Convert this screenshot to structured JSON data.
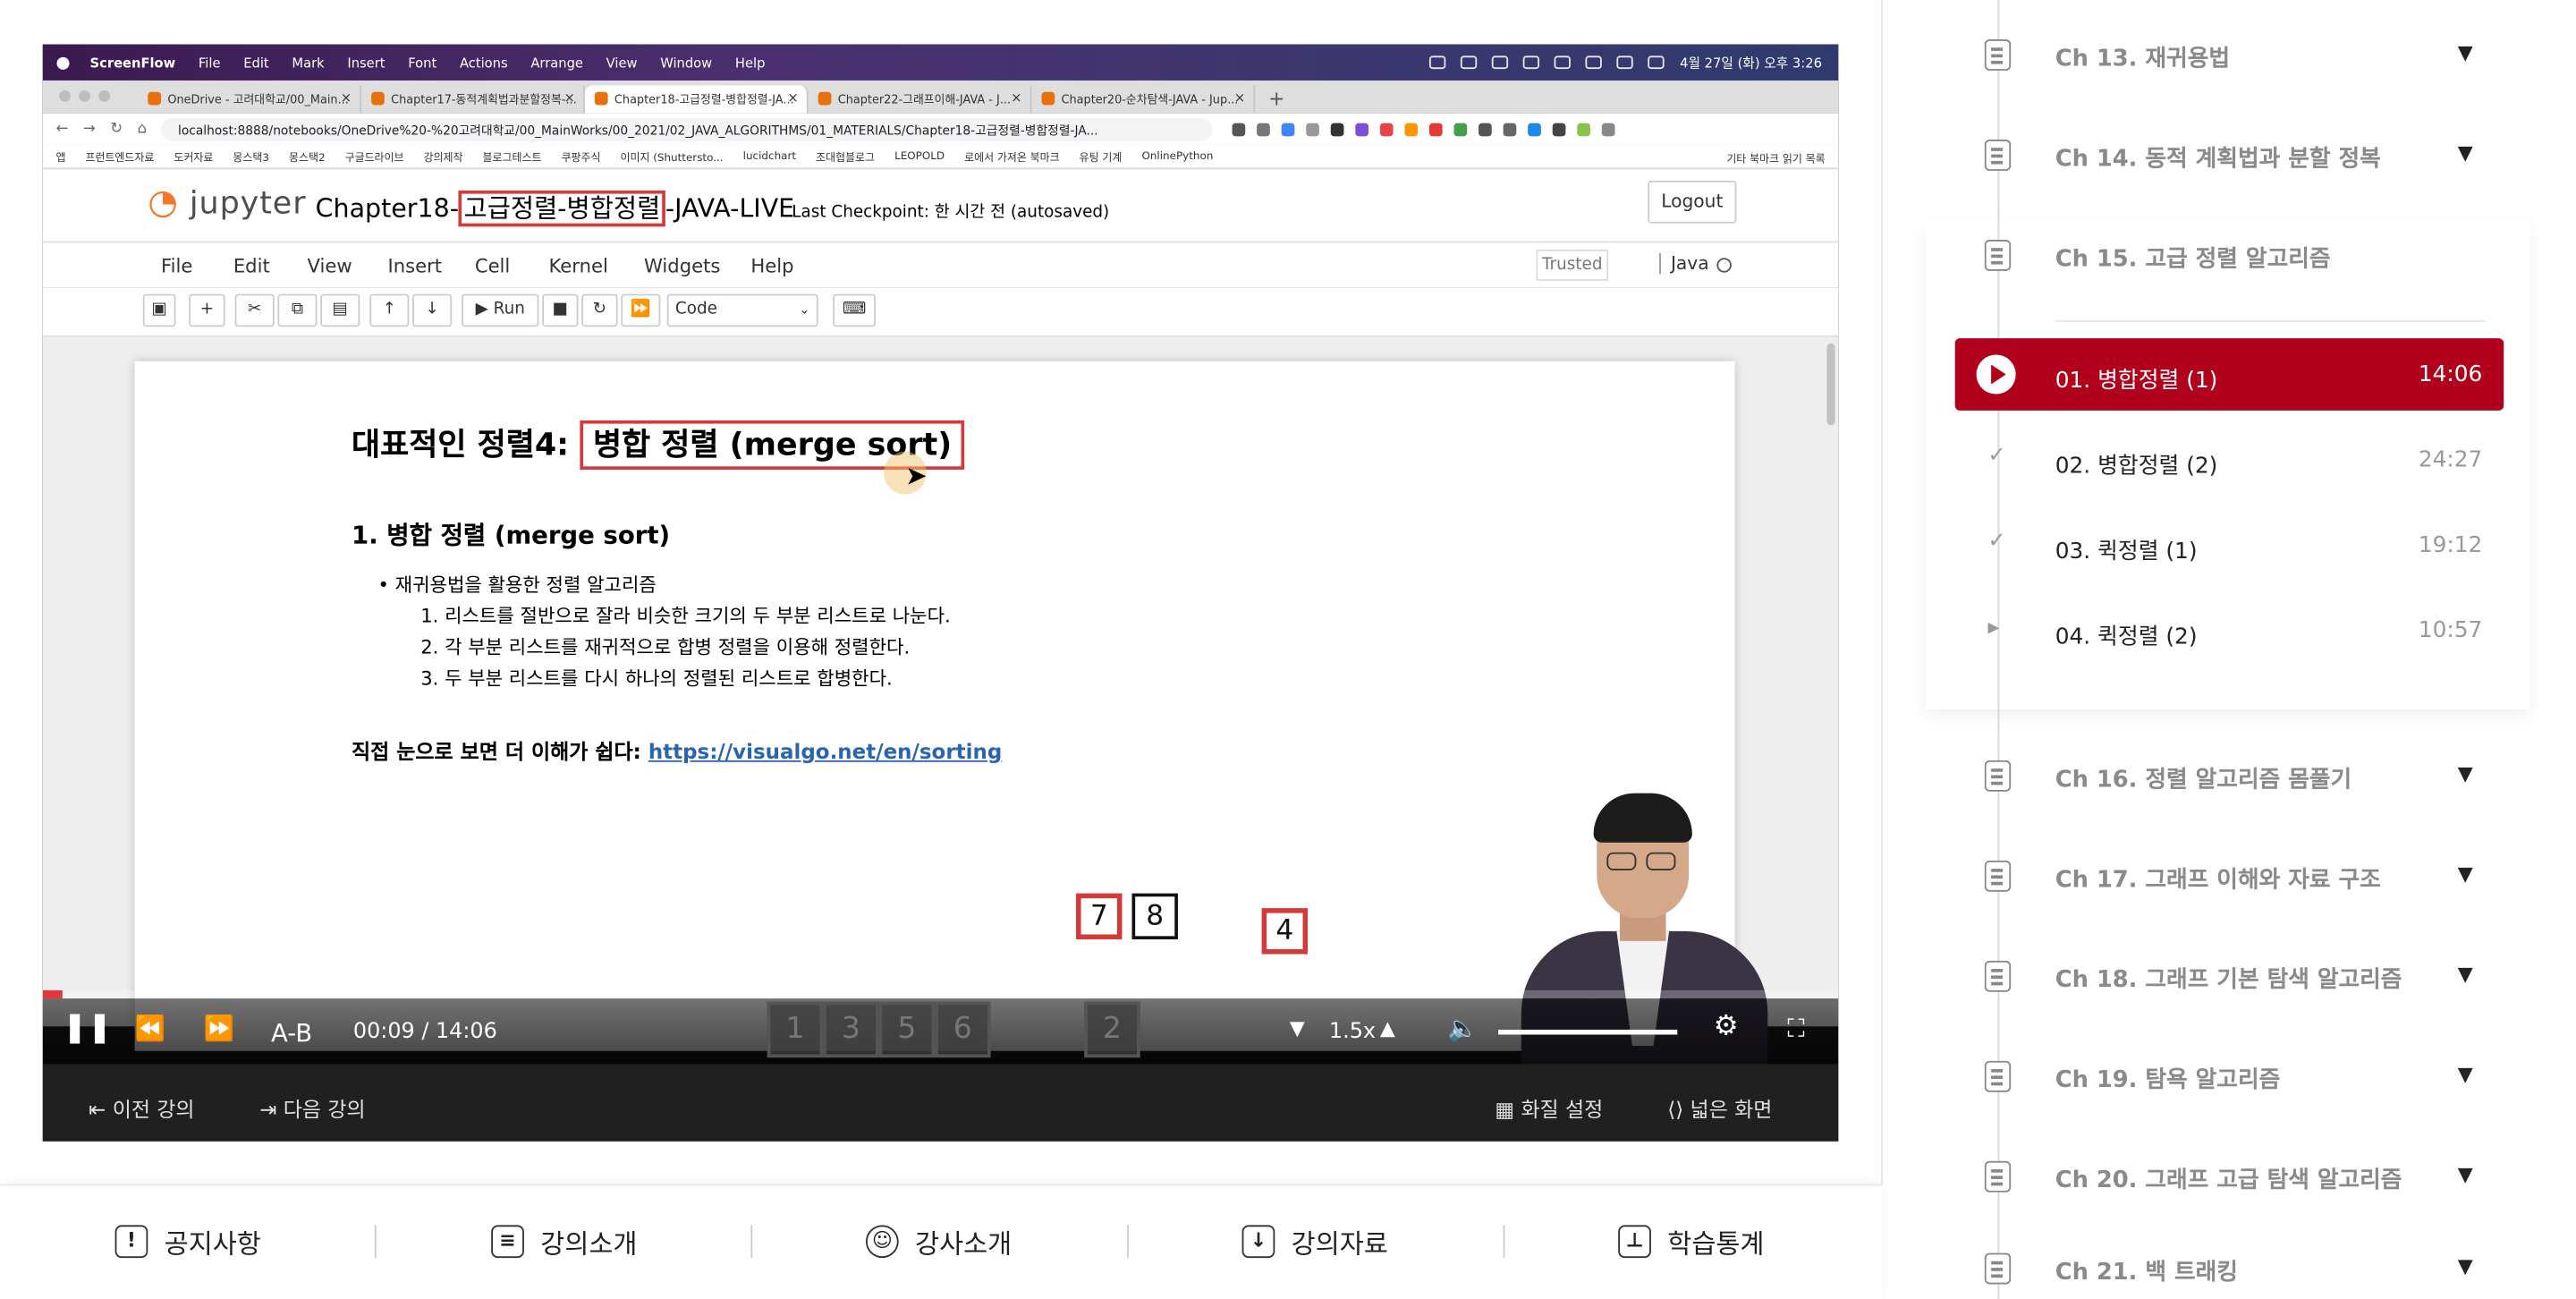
{
  "mac_menubar": {
    "app": "ScreenFlow",
    "items": [
      "File",
      "Edit",
      "Mark",
      "Insert",
      "Font",
      "Actions",
      "Arrange",
      "View",
      "Window",
      "Help"
    ],
    "clock": "4월 27일 (화) 오후 3:26"
  },
  "browser": {
    "tabs": [
      "OneDrive - 고려대학교/00_Main...",
      "Chapter17-동적계획법과분할정복-...",
      "Chapter18-고급정렬-병합정렬-JA...",
      "Chapter22-그래프이해-JAVA - J...",
      "Chapter20-순차탐색-JAVA - Jup..."
    ],
    "url": "localhost:8888/notebooks/OneDrive%20-%20고려대학교/00_MainWorks/00_2021/02_JAVA_ALGORITHMS/01_MATERIALS/Chapter18-고급정렬-병합정렬-JA...",
    "bookmarks": [
      "앱",
      "프런트엔드자료",
      "도커자료",
      "몽스택3",
      "몽스택2",
      "구글드라이브",
      "강의제작",
      "블로그테스트",
      "쿠팡주식",
      "이미지 (Shuttersto...",
      "lucidchart",
      "조대협블로그",
      "LEOPOLD",
      "로에서 가져온 북마크",
      "유팅 기계",
      "OnlinePython"
    ],
    "bookmarks_right": [
      "기타 북마크",
      "읽기 목록"
    ]
  },
  "jupyter": {
    "logo": "jupyter",
    "title_prefix": "Chapter18-",
    "title_highlight": "고급정렬-병합정렬",
    "title_suffix": "-JAVA-LIVE",
    "checkpoint": "Last Checkpoint: 한 시간 전  (autosaved)",
    "logout": "Logout",
    "menu": [
      "File",
      "Edit",
      "View",
      "Insert",
      "Cell",
      "Kernel",
      "Widgets",
      "Help"
    ],
    "trusted": "Trusted",
    "kernel": "Java",
    "run_label": "Run",
    "cell_type": "Code"
  },
  "notebook": {
    "h1_prefix": "대표적인 정렬4: ",
    "h1_highlight": "병합 정렬 (merge sort)",
    "h2": "1. 병합 정렬 (merge sort)",
    "bullet": "재귀용법을 활용한 정렬 알고리즘",
    "steps": [
      "1. 리스트를 절반으로 잘라 비슷한 크기의 두 부분 리스트로 나눈다.",
      "2. 각 부분 리스트를 재귀적으로 합병 정렬을 이용해 정렬한다.",
      "3. 두 부분 리스트를 다시 하나의 정렬된 리스트로 합병한다."
    ],
    "link_label": "직접 눈으로 보면 더 이해가 쉽다: ",
    "link": "https://visualgo.net/en/sorting",
    "anim_top": [
      "7",
      "8",
      "4"
    ],
    "anim_bottom": [
      "1",
      "3",
      "5",
      "6",
      "2"
    ]
  },
  "player": {
    "progress": 0.011,
    "ab_label": "A-B",
    "current_time": "00:09",
    "separator": "/",
    "duration": "14:06",
    "speed": "1.5x",
    "volume": 0.88,
    "prev_lecture": "이전 강의",
    "next_lecture": "다음 강의",
    "quality": "화질 설정",
    "wide": "넓은 화면"
  },
  "bottom_nav": [
    "공지사항",
    "강의소개",
    "강사소개",
    "강의자료",
    "학습통계"
  ],
  "sidebar": {
    "chapters_top": [
      "Ch 13. 재귀용법",
      "Ch 14. 동적 계획법과 분할 정복",
      "Ch 15. 고급 정렬 알고리즘"
    ],
    "lessons": [
      {
        "title": "01. 병합정렬 (1)",
        "duration": "14:06"
      },
      {
        "title": "02. 병합정렬 (2)",
        "duration": "24:27"
      },
      {
        "title": "03. 퀵정렬 (1)",
        "duration": "19:12"
      },
      {
        "title": "04. 퀵정렬 (2)",
        "duration": "10:57"
      }
    ],
    "chapters_bottom": [
      "Ch 16. 정렬 알고리즘 몸풀기",
      "Ch 17. 그래프 이해와 자료 구조",
      "Ch 18. 그래프 기본 탐색 알고리즘",
      "Ch 19. 탐욕 알고리즘",
      "Ch 20. 그래프 고급 탐색 알고리즘",
      "Ch 21. 백 트래킹"
    ]
  },
  "colors": {
    "accent": "#b0001c",
    "progress": "#e0383e",
    "highlight_box": "#d43a3a"
  }
}
